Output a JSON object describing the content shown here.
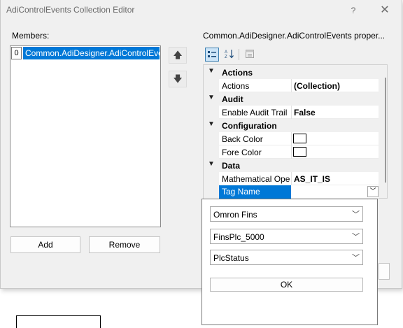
{
  "window": {
    "title": "AdiControlEvents Collection Editor",
    "help_glyph": "?",
    "close_glyph": "✕"
  },
  "members": {
    "label": "Members:",
    "items": [
      {
        "index": "0",
        "text": "Common.AdiDesigner.AdiControlEvents"
      }
    ]
  },
  "buttons": {
    "add": "Add",
    "remove": "Remove",
    "move_up": "🡅",
    "move_down": "🡇"
  },
  "properties": {
    "label": "Common.AdiDesigner.AdiControlEvents proper...",
    "toolbar": {
      "categorized_icon": "categorized-icon",
      "alphabetical_icon": "alphabetical-icon",
      "property_pages_icon": "property-pages-icon"
    },
    "categories": [
      {
        "name": "Actions",
        "rows": [
          {
            "name": "Actions",
            "value": "(Collection)"
          }
        ]
      },
      {
        "name": "Audit",
        "rows": [
          {
            "name": "Enable Audit Trail",
            "value": "False"
          }
        ]
      },
      {
        "name": "Configuration",
        "rows": [
          {
            "name": "Back Color",
            "value": ""
          },
          {
            "name": "Fore Color",
            "value": ""
          }
        ]
      },
      {
        "name": "Data",
        "rows": [
          {
            "name": "Mathematical Ope",
            "value": "AS_IT_IS"
          },
          {
            "name": "Tag Name",
            "value": ""
          }
        ]
      }
    ]
  },
  "dropdown": {
    "driver": "Omron Fins",
    "device": "FinsPlc_5000",
    "tag": "PlcStatus",
    "ok": "OK"
  },
  "colors": {
    "accent": "#0078d7",
    "dialog_bg": "#f0f0f0"
  }
}
